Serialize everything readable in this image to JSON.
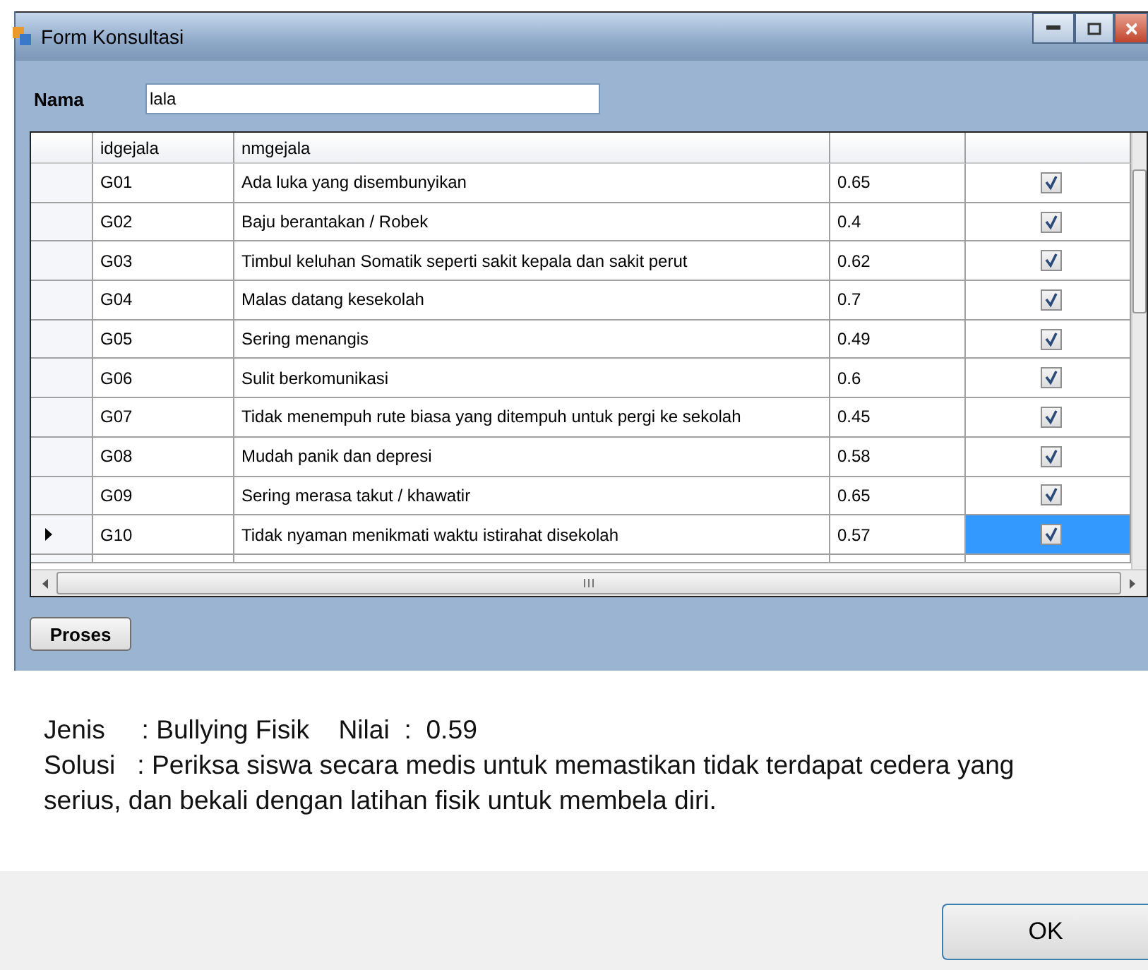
{
  "window": {
    "title": "Form Konsultasi"
  },
  "name_field": {
    "label": "Nama",
    "value": "lala"
  },
  "table": {
    "columns": [
      "idgejala",
      "nmgejala"
    ],
    "rows": [
      {
        "id": "G01",
        "name": "Ada luka yang disembunyikan",
        "value": "0.65",
        "checked": true,
        "selected": false
      },
      {
        "id": "G02",
        "name": "Baju berantakan / Robek",
        "value": "0.4",
        "checked": true,
        "selected": false
      },
      {
        "id": "G03",
        "name": "Timbul keluhan Somatik seperti sakit kepala dan sakit perut",
        "value": "0.62",
        "checked": true,
        "selected": false
      },
      {
        "id": "G04",
        "name": "Malas datang kesekolah",
        "value": "0.7",
        "checked": true,
        "selected": false
      },
      {
        "id": "G05",
        "name": "Sering menangis",
        "value": "0.49",
        "checked": true,
        "selected": false
      },
      {
        "id": "G06",
        "name": "Sulit berkomunikasi",
        "value": "0.6",
        "checked": true,
        "selected": false
      },
      {
        "id": "G07",
        "name": "Tidak menempuh rute biasa yang ditempuh untuk pergi ke sekolah",
        "value": "0.45",
        "checked": true,
        "selected": false
      },
      {
        "id": "G08",
        "name": "Mudah panik dan depresi",
        "value": "0.58",
        "checked": true,
        "selected": false
      },
      {
        "id": "G09",
        "name": "Sering merasa takut / khawatir",
        "value": "0.65",
        "checked": true,
        "selected": false
      },
      {
        "id": "G10",
        "name": "Tidak nyaman menikmati waktu istirahat disekolah",
        "value": "0.57",
        "checked": true,
        "selected": true
      }
    ]
  },
  "process_button": "Proses",
  "message": {
    "result_line": "Jenis     : Bullying Fisik    Nilai  :  0.59",
    "solution": "Solusi   : Periksa siswa secara medis untuk memastikan tidak terdapat cedera yang serius, dan bekali dengan latihan fisik untuk membela diri."
  },
  "ok_button": "OK"
}
